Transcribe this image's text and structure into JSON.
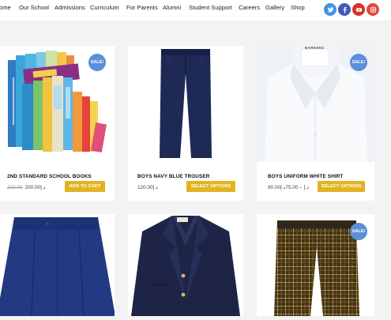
{
  "nav": {
    "items": [
      "ome",
      "Our School",
      "Admissions",
      "Curriculum",
      "For Parents",
      "Alumni",
      "Student Support",
      "Careers",
      "Gallery",
      "Shop"
    ],
    "social": [
      {
        "icon": "twitter-icon",
        "color": "#3d97e0"
      },
      {
        "icon": "facebook-icon",
        "color": "#3b5cb8"
      },
      {
        "icon": "youtube-icon",
        "color": "#d8302b"
      },
      {
        "icon": "instagram-icon",
        "color": "#e0483f"
      }
    ]
  },
  "products": [
    {
      "name": "2ND STANDARD SCHOOL BOOKS",
      "old_price": "220.00",
      "price": "200.00",
      "currency": "د.إ",
      "button": "ADD TO CART",
      "badge": "SALE!"
    },
    {
      "name": "BOYS NAVY BLUE TROUSER",
      "price": "120.00",
      "currency": "د.إ",
      "button": "SELECT OPTIONS"
    },
    {
      "name": "BOYS UNIFORM WHITE SHIRT",
      "price": "90.00",
      "price_max": "75.00",
      "currency": "د.إ",
      "button": "SELECT OPTIONS",
      "badge": "SALE!",
      "label_text": "BARKERS"
    },
    {
      "name": "",
      "badge": ""
    },
    {
      "name": "",
      "label_text": ""
    },
    {
      "name": "",
      "badge": "SALE!"
    }
  ],
  "colors": {
    "accent": "#e2b422",
    "sale_badge": "#5b8fd6",
    "navy": "#1e2a55"
  }
}
